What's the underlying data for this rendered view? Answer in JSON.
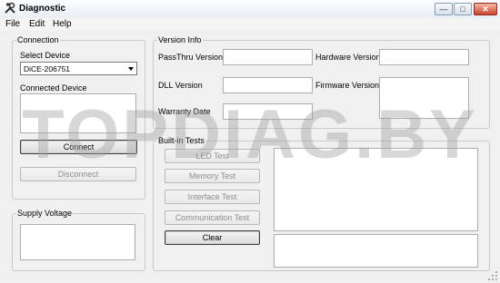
{
  "window": {
    "title": "Diagnostic",
    "minimize_icon": "minimize-icon",
    "maximize_icon": "maximize-icon",
    "close_icon": "close-icon"
  },
  "menu": {
    "items": [
      "File",
      "Edit",
      "Help"
    ]
  },
  "connection": {
    "group_title": "Connection",
    "select_device_label": "Select Device",
    "selected_device": "DiCE-206751",
    "connected_device_label": "Connected Device",
    "connect_button": "Connect",
    "disconnect_button": "Disconnect"
  },
  "supply": {
    "group_title": "Supply Voltage"
  },
  "version": {
    "group_title": "Version Info",
    "passthru_label": "PassThru Version",
    "hardware_label": "Hardware Version",
    "dll_label": "DLL Version",
    "firmware_label": "Firmware Version",
    "warranty_label": "Warranty Date"
  },
  "tests": {
    "group_title": "Built-in Tests",
    "led_button": "LED Test",
    "memory_button": "Memory Test",
    "interface_button": "Interface Test",
    "communication_button": "Communication Test",
    "clear_button": "Clear"
  },
  "watermark": "TOPDIAG.BY",
  "colors": {
    "window_bg": "#f0f0f0",
    "close_button": "#c9452c",
    "disabled_text": "#8e8e8e"
  }
}
